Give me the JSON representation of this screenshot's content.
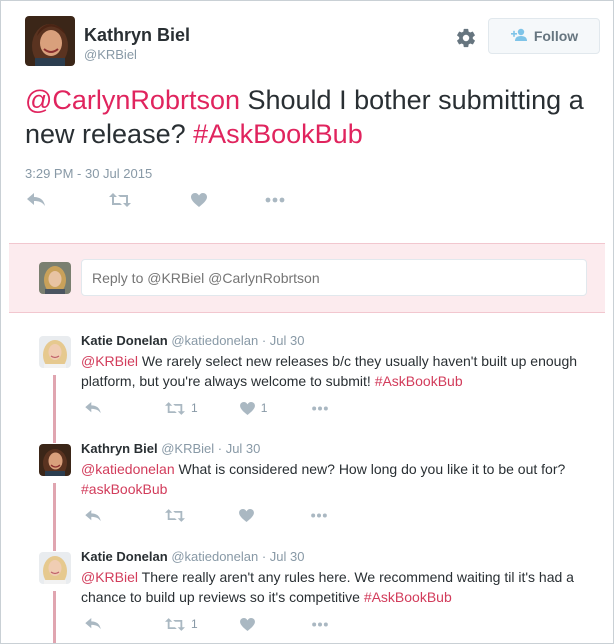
{
  "main_tweet": {
    "author_name": "Kathryn Biel",
    "author_handle": "@KRBiel",
    "follow_label": "Follow",
    "text_mention": "@CarlynRobrtson",
    "text_body": " Should I bother submitting a new release? ",
    "text_hashtag": "#AskBookBub",
    "timestamp": "3:29 PM - 30 Jul 2015",
    "actions": [
      "reply-icon",
      "retweet-icon",
      "like-icon",
      "more-icon"
    ]
  },
  "reply_box": {
    "placeholder": "Reply to @KRBiel @CarlynRobrtson"
  },
  "conversation": [
    {
      "name": "Katie Donelan",
      "handle": "@katiedonelan · Jul 30",
      "mention": "@KRBiel",
      "text": " We rarely select new releases b/c they usually haven't built up enough platform, but you're always welcome to submit! ",
      "hashtag": "#AskBookBub",
      "retweets": "1",
      "likes": "1"
    },
    {
      "name": "Kathryn Biel",
      "handle": "@KRBiel · Jul 30",
      "mention": "@katiedonelan",
      "text": " What is considered new? How long do you like it to be out for? ",
      "hashtag": "#askBookBub",
      "retweets": "",
      "likes": ""
    },
    {
      "name": "Katie Donelan",
      "handle": "@katiedonelan · Jul 30",
      "mention": "@KRBiel",
      "text": " There really aren't any rules here. We recommend waiting til it's had a chance to build up reviews so it's competitive ",
      "hashtag": "#AskBookBub",
      "retweets": "1",
      "likes": ""
    }
  ],
  "colors": {
    "accent": "#e0245e",
    "muted": "#8899a6",
    "thread_line": "#e0a5b0",
    "reply_box_bg": "#fcebee"
  }
}
